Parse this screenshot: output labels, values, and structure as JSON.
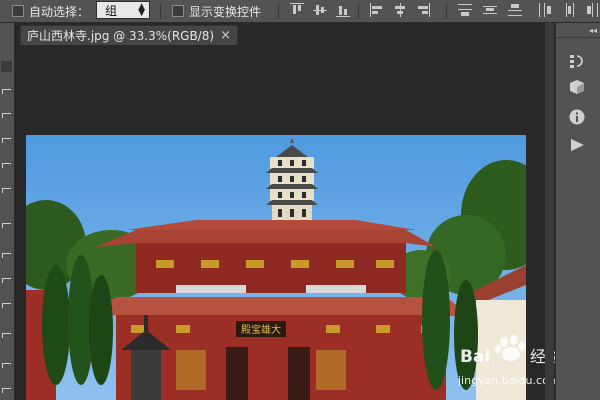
{
  "options_bar": {
    "auto_select_label": "自动选择：",
    "auto_select_value": "组",
    "show_transform_label": "显示变换控件"
  },
  "document_tab": {
    "title": "庐山西林寺.jpg @ 33.3%(RGB/8)",
    "close_glyph": "×"
  },
  "panel": {
    "collapse_glyph": "◂◂",
    "icons": [
      "history-icon",
      "3d-icon",
      "info-icon",
      "play-icon"
    ]
  },
  "photo": {
    "plaque_text": "殿宝雄大"
  },
  "watermark": {
    "brand": "Bai",
    "brand_cn": "经验",
    "url": "jingyan.baidu.com"
  },
  "colors": {
    "ui_gray": "#535353",
    "workspace": "#282828",
    "sky": "#5ea4e4",
    "temple_red": "#9b2e25",
    "roof_red": "#b44a3a"
  }
}
